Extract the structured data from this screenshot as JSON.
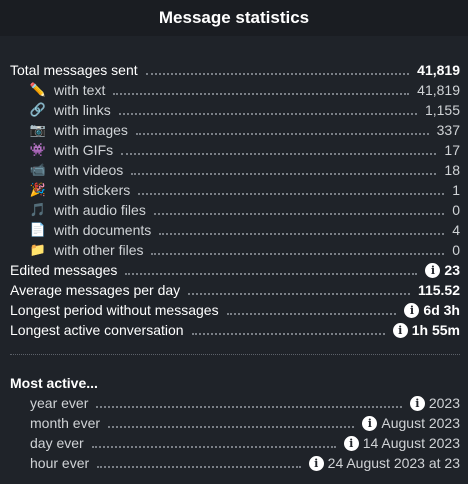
{
  "header": {
    "title": "Message statistics"
  },
  "totals": {
    "total_label": "Total messages sent",
    "total_value": "41,819",
    "breakdown": [
      {
        "icon": "pencil-icon",
        "glyph": "✏️",
        "label": "with text",
        "value": "41,819"
      },
      {
        "icon": "link-icon",
        "glyph": "🔗",
        "label": "with links",
        "value": "1,155"
      },
      {
        "icon": "camera-icon",
        "glyph": "📷",
        "label": "with images",
        "value": "337"
      },
      {
        "icon": "alien-monster-icon",
        "glyph": "👾",
        "label": "with GIFs",
        "value": "17"
      },
      {
        "icon": "video-camera-icon",
        "glyph": "📹",
        "label": "with videos",
        "value": "18"
      },
      {
        "icon": "party-popper-icon",
        "glyph": "🎉",
        "label": "with stickers",
        "value": "1"
      },
      {
        "icon": "music-note-icon",
        "glyph": "🎵",
        "label": "with audio files",
        "value": "0"
      },
      {
        "icon": "document-icon",
        "glyph": "📄",
        "label": "with documents",
        "value": "4"
      },
      {
        "icon": "folder-icon",
        "glyph": "📁",
        "label": "with other files",
        "value": "0"
      }
    ],
    "edited": {
      "label": "Edited messages",
      "value": "23"
    },
    "average": {
      "label": "Average messages per day",
      "value": "115.52"
    },
    "longest_gap": {
      "label": "Longest period without messages",
      "value": "6d 3h"
    },
    "longest_conv": {
      "label": "Longest active conversation",
      "value": "1h 55m"
    }
  },
  "most_active": {
    "title": "Most active...",
    "items": [
      {
        "label": "year ever",
        "value": "2023"
      },
      {
        "label": "month ever",
        "value": "August 2023"
      },
      {
        "label": "day ever",
        "value": "14 August 2023"
      },
      {
        "label": "hour ever",
        "value": "24 August 2023 at 23"
      }
    ]
  },
  "info_glyph": "i"
}
